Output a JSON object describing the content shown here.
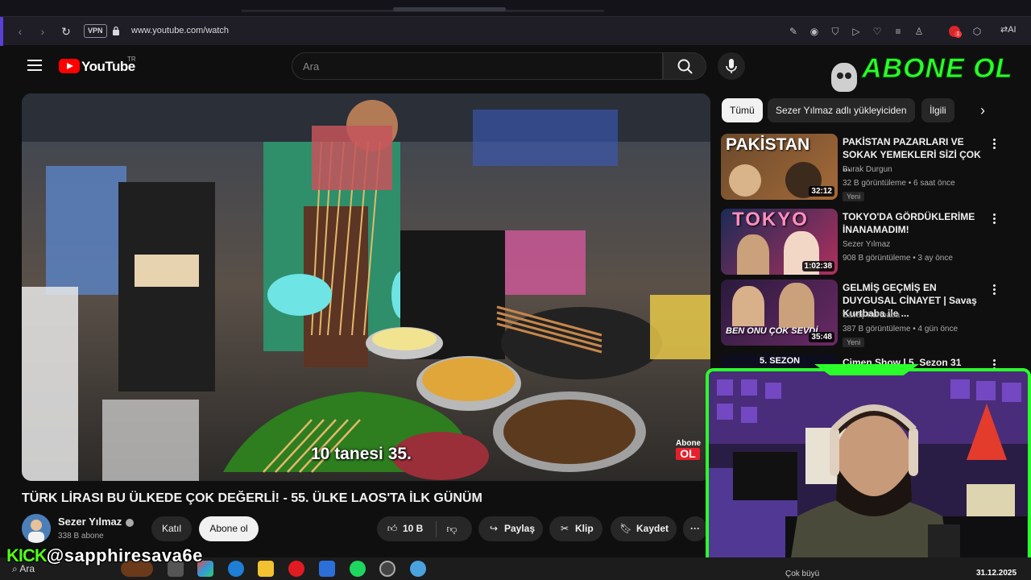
{
  "browser": {
    "vpn_label": "VPN",
    "url": "www.youtube.com/watch",
    "ai_label": "AI",
    "extension_badge": "1"
  },
  "header": {
    "logo_text": "YouTube",
    "country_code": "TR",
    "search_placeholder": "Ara"
  },
  "overlay": {
    "abone_text": "ABONE OL"
  },
  "video": {
    "subtitle": "10 tanesi 35.",
    "watermark_small": "Abone",
    "watermark_big": "OL",
    "title": "TÜRK LİRASI BU ÜLKEDE ÇOK DEĞERLİ! - 55. ÜLKE LAOS'TA İLK GÜNÜM",
    "channel_name": "Sezer Yılmaz",
    "subscribers": "338 B abone",
    "join_label": "Katıl",
    "subscribe_label": "Abone ol",
    "like_count": "10 B",
    "share_label": "Paylaş",
    "clip_label": "Klip",
    "save_label": "Kaydet"
  },
  "chips": [
    {
      "label": "Tümü"
    },
    {
      "label": "Sezer Yılmaz adlı yükleyiciden"
    },
    {
      "label": "İlgili"
    }
  ],
  "recommendations": [
    {
      "thumb_text": "PAKİSTAN",
      "duration": "32:12",
      "title": "PAKİSTAN PAZARLARI VE SOKAK YEMEKLERİ SİZİ ÇOK ...",
      "channel": "Burak Durgun",
      "meta": "32 B görüntüleme • 6 saat önce",
      "badge": "Yeni"
    },
    {
      "thumb_text": "TOKYO",
      "duration": "1:02:38",
      "title": "TOKYO'DA GÖRDÜKLERİME İNANAMADIM!",
      "channel": "Sezer Yılmaz",
      "meta": "908 B görüntüleme • 3 ay önce",
      "badge": ""
    },
    {
      "thumb_text": "BEN ONU ÇOK SEVDİ",
      "duration": "35:48",
      "title": "GELMİŞ GEÇMİŞ EN DUYGUSAL CİNAYET | Savaş Kurtbaba ile ...",
      "channel": "Savaş Kurtbaba",
      "meta": "387 B görüntüleme • 4 gün önce",
      "badge": "Yeni"
    },
    {
      "thumb_text": "5. SEZON",
      "duration": "",
      "title": "Çimen Show | 5. Sezon 31",
      "channel": "",
      "meta": "",
      "badge": ""
    }
  ],
  "stream": {
    "kick_label": "KICK",
    "handle": "@sapphiresava6e",
    "date": "31.12.2025",
    "cam_caption": "Çok büyü"
  },
  "taskbar": {
    "search_label": "Ara"
  },
  "colors": {
    "accent_green": "#2bff2b",
    "youtube_red": "#ff0000",
    "kick_green": "#53fc18"
  }
}
